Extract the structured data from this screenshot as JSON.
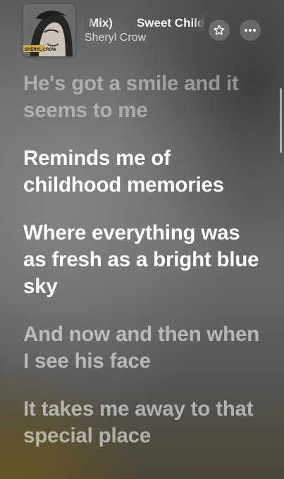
{
  "now_playing": {
    "title_visible_fragment": "w Mix)",
    "title": "Sweet Child",
    "artist": "Sheryl Crow",
    "artwork_label": "SHERYL CROW"
  },
  "header": {
    "favorite_icon": "star-icon",
    "more_icon": "ellipsis-icon"
  },
  "lyrics": [
    {
      "text": "He's got a smile and it seems to me",
      "state": "past"
    },
    {
      "text": "Reminds me of childhood memories",
      "state": "current"
    },
    {
      "text": "Where everything was as fresh as a bright blue sky",
      "state": "current"
    },
    {
      "text": "And now and then when I see his face",
      "state": "future"
    },
    {
      "text": "It takes me away to that special place",
      "state": "future"
    }
  ],
  "colors": {
    "lyric_active": "#ffffff",
    "background_tint": "#6a6a6a"
  }
}
